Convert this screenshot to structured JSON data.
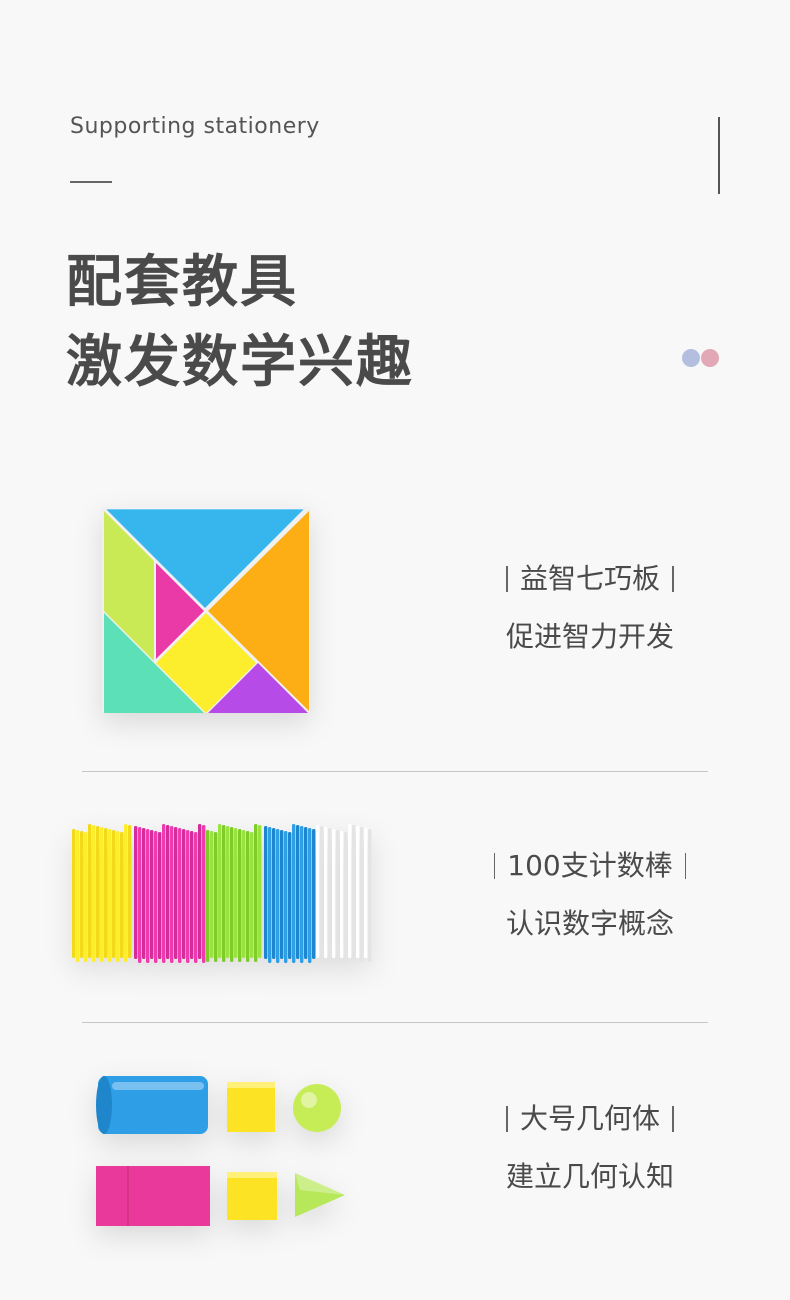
{
  "header": {
    "eyebrow": "Supporting stationery",
    "headline_line1": "配套教具",
    "headline_line2": "激发数学兴趣"
  },
  "features": [
    {
      "title": "益智七巧板",
      "subtitle": "促进智力开发",
      "image": "tangram-puzzle"
    },
    {
      "title": "100支计数棒",
      "subtitle": "认识数字概念",
      "image": "counting-sticks"
    },
    {
      "title": "大号几何体",
      "subtitle": "建立几何认知",
      "image": "geometric-solids"
    }
  ],
  "colors": {
    "background": "#f8f8f8",
    "text": "#4a4a4a",
    "dot_blue": "#b4bfe0",
    "dot_pink": "#e3a8b5",
    "cyan": "#36b6ec",
    "orange": "#fcae14",
    "magenta": "#e93aa8",
    "yellow": "#fcee2c",
    "lime": "#c9ea55",
    "mint": "#5ce0b8",
    "purple": "#b64be8",
    "blue": "#2e9ee6",
    "green": "#8fde3a"
  }
}
